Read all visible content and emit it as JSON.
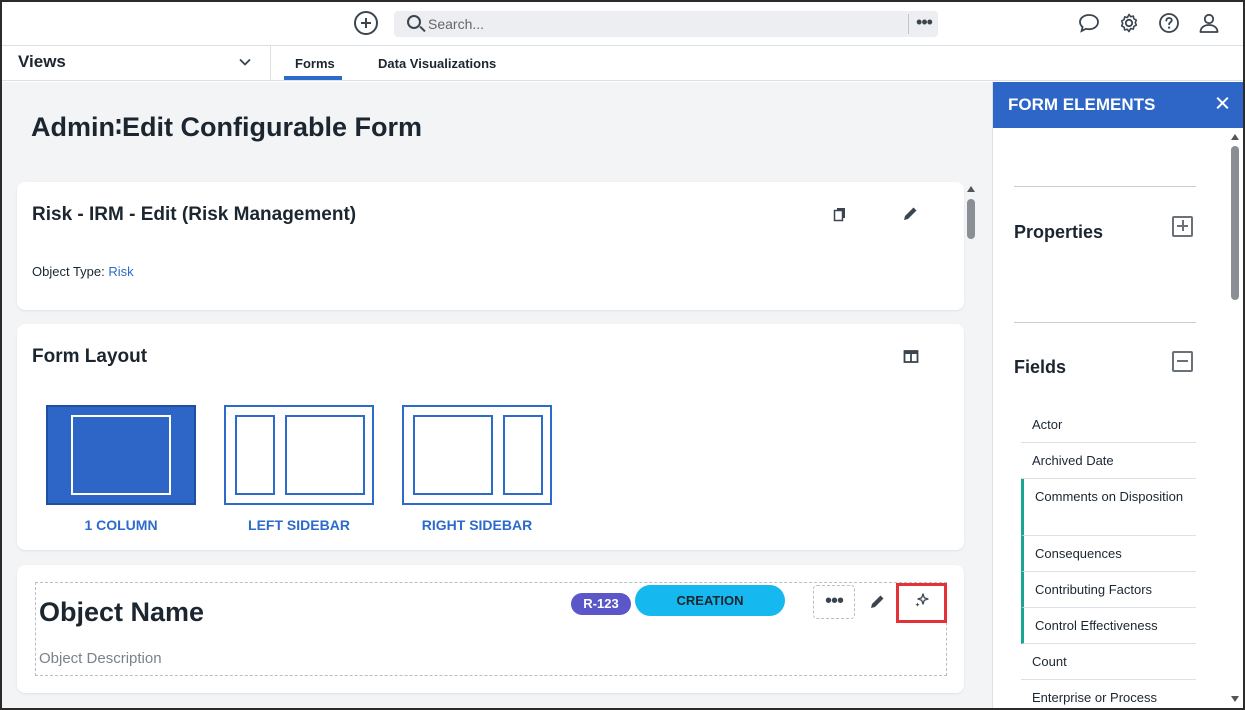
{
  "topbar": {
    "search_placeholder": "Search...",
    "more_label": "•••",
    "icons": [
      "add-circle-icon",
      "search-icon",
      "chat-icon",
      "gear-icon",
      "help-icon",
      "user-icon"
    ]
  },
  "views": {
    "label": "Views",
    "tabs": [
      {
        "label": "Forms",
        "active": true
      },
      {
        "label": "Data Visualizations",
        "active": false
      }
    ]
  },
  "main": {
    "title": "Admin∶Edit Configurable Form",
    "form_card": {
      "title": "Risk - IRM - Edit (Risk Management)",
      "object_type_label": "Object Type: ",
      "object_type_value": "Risk"
    },
    "layout_card": {
      "title": "Form Layout",
      "options": [
        {
          "label": "1 COLUMN",
          "selected": true
        },
        {
          "label": "LEFT SIDEBAR",
          "selected": false
        },
        {
          "label": "RIGHT SIDEBAR",
          "selected": false
        }
      ]
    },
    "object_card": {
      "name": "Object Name",
      "description": "Object Description",
      "id_badge": "R-123",
      "status_badge": "CREATION",
      "more_label": "•••"
    }
  },
  "panel": {
    "title": "FORM ELEMENTS",
    "properties_label": "Properties",
    "fields_label": "Fields",
    "fields": [
      {
        "label": "Actor",
        "marked": false
      },
      {
        "label": "Archived Date",
        "marked": false
      },
      {
        "label": "Comments on Disposition",
        "marked": true
      },
      {
        "label": "Consequences",
        "marked": true
      },
      {
        "label": "Contributing Factors",
        "marked": true
      },
      {
        "label": "Control Effectiveness",
        "marked": true
      },
      {
        "label": "Count",
        "marked": false
      },
      {
        "label": "Enterprise or Process",
        "marked": false
      }
    ]
  },
  "colors": {
    "accent": "#2d66c7",
    "id_badge": "#5b57c9",
    "status_badge": "#16b9ef",
    "highlight": "#e53238",
    "field_marker": "#1aa491"
  }
}
